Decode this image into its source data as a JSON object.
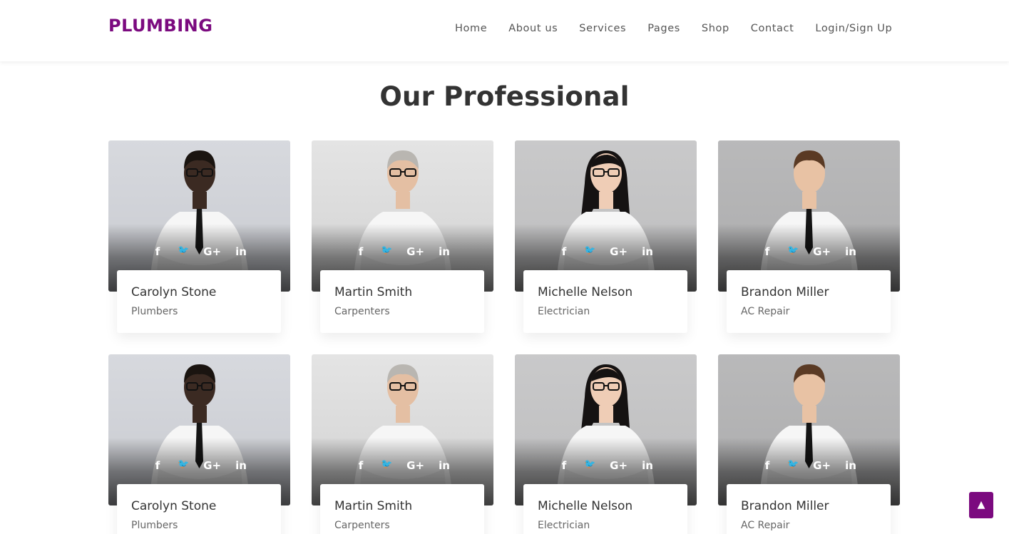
{
  "brand": {
    "logo": "PLUMBING",
    "accent_color": "#7b0a7f"
  },
  "nav": {
    "items": [
      "Home",
      "About us",
      "Services",
      "Pages",
      "Shop",
      "Contact",
      "Login/Sign Up"
    ]
  },
  "section": {
    "title": "Our Professional"
  },
  "social_icons": [
    {
      "name": "facebook-icon",
      "glyph": "f"
    },
    {
      "name": "twitter-icon",
      "glyph": "🐦"
    },
    {
      "name": "google-plus-icon",
      "glyph": "G+"
    },
    {
      "name": "linkedin-icon",
      "glyph": "in"
    }
  ],
  "team": [
    {
      "name": "Carolyn Stone",
      "role": "Plumbers"
    },
    {
      "name": "Martin Smith",
      "role": "Carpenters"
    },
    {
      "name": "Michelle Nelson",
      "role": "Electrician"
    },
    {
      "name": "Brandon Miller",
      "role": "AC Repair"
    },
    {
      "name": "Carolyn Stone",
      "role": "Plumbers"
    },
    {
      "name": "Martin Smith",
      "role": "Carpenters"
    },
    {
      "name": "Michelle Nelson",
      "role": "Electrician"
    },
    {
      "name": "Brandon Miller",
      "role": "AC Repair"
    }
  ],
  "scroll_top": {
    "icon": "chevron-up-icon",
    "glyph": "▲"
  }
}
